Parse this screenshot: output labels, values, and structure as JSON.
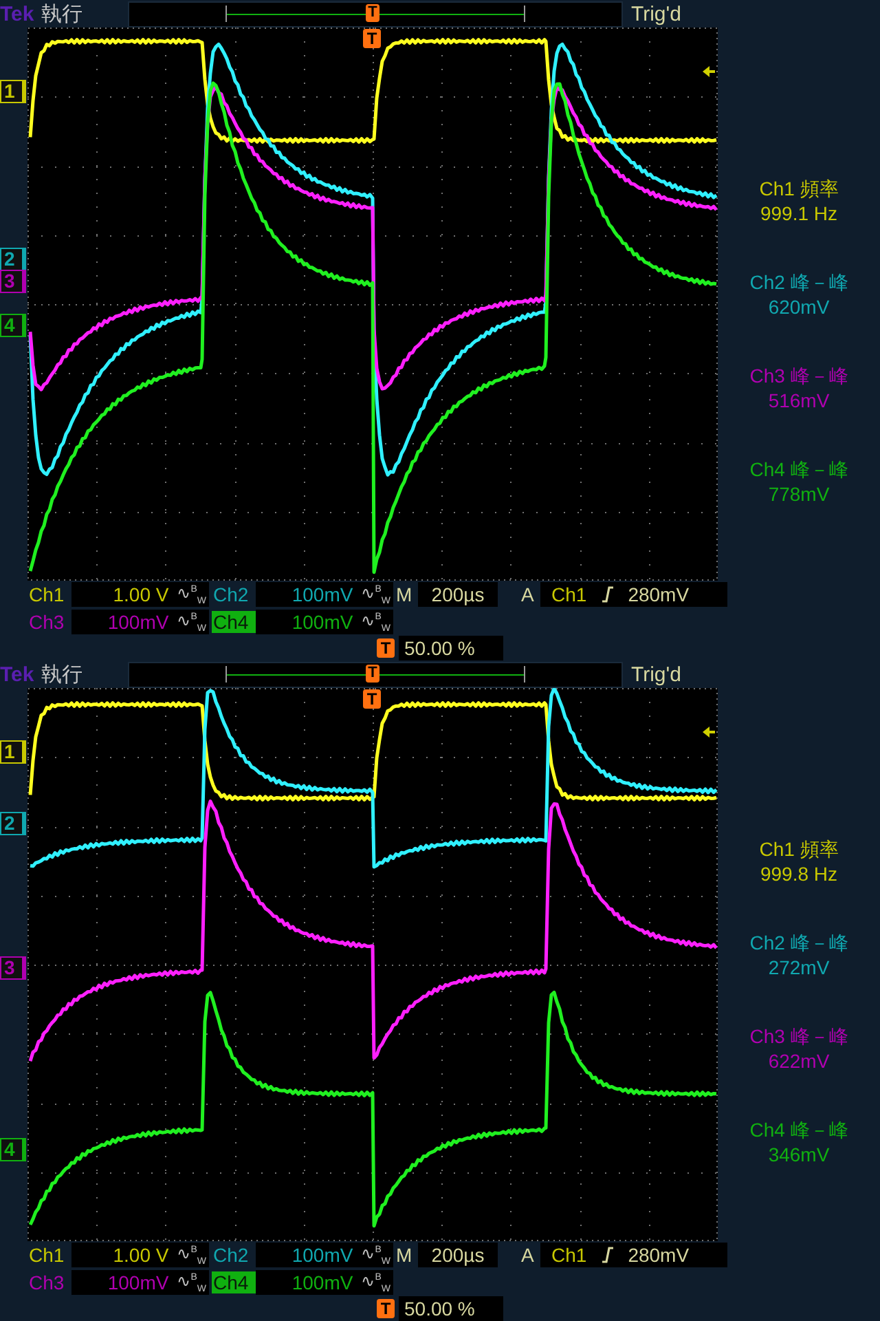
{
  "panels": [
    {
      "header": {
        "brand": "Tek",
        "run_state": "執行",
        "trigger_marker": "T",
        "trigger_status": "Trig'd"
      },
      "plot": {
        "trigger_marker": "T"
      },
      "channel_markers": [
        {
          "label": "1",
          "color": "#c8c800"
        },
        {
          "label": "2",
          "color": "#10a8b0"
        },
        {
          "label": "3",
          "color": "#b000b0"
        },
        {
          "label": "4",
          "color": "#10b010"
        }
      ],
      "traces": [
        {
          "color": "#ffff20"
        },
        {
          "color": "#30f0ff"
        },
        {
          "color": "#ff20ff"
        },
        {
          "color": "#20f020"
        }
      ],
      "measurements": [
        {
          "label": "Ch1 頻率",
          "value": "999.1 Hz",
          "color": "#c8c800"
        },
        {
          "label": "Ch2 峰－峰",
          "value": "620mV",
          "color": "#10a8b0"
        },
        {
          "label": "Ch3 峰－峰",
          "value": "516mV",
          "color": "#b000b0"
        },
        {
          "label": "Ch4 峰－峰",
          "value": "778mV",
          "color": "#10b010"
        }
      ],
      "settings_rows": [
        [
          {
            "kind": "channel",
            "label": "Ch1",
            "value": "1.00 V",
            "bw": "∿$^{B}$$_{W}$",
            "selected": false,
            "color": "#c8c800"
          },
          {
            "kind": "channel",
            "label": "Ch2",
            "value": "100mV",
            "bw": "∿$^{B}$$_{W}$",
            "selected": false,
            "color": "#10a8b0"
          },
          {
            "kind": "timebase",
            "label": "M",
            "value": "200µs"
          },
          {
            "kind": "trigger",
            "label": "A",
            "source": "Ch1",
            "threshold": "280mV"
          }
        ],
        [
          {
            "kind": "channel",
            "label": "Ch3",
            "value": "100mV",
            "bw": "∿$^{B}$$_{W}$",
            "selected": false,
            "color": "#b000b0"
          },
          {
            "kind": "channel",
            "label": "Ch4",
            "value": "100mV",
            "bw": "∿$^{B}$$_{W}$",
            "selected": true,
            "color": "#10b010"
          }
        ]
      ],
      "trigger_position": {
        "marker": "T",
        "value": "50.00 %"
      }
    },
    {
      "header": {
        "brand": "Tek",
        "run_state": "執行",
        "trigger_marker": "T",
        "trigger_status": "Trig'd"
      },
      "plot": {
        "trigger_marker": "T"
      },
      "channel_markers": [
        {
          "label": "1",
          "color": "#c8c800"
        },
        {
          "label": "2",
          "color": "#10a8b0"
        },
        {
          "label": "3",
          "color": "#b000b0"
        },
        {
          "label": "4",
          "color": "#10b010"
        }
      ],
      "traces": [
        {
          "color": "#ffff20"
        },
        {
          "color": "#30f0ff"
        },
        {
          "color": "#ff20ff"
        },
        {
          "color": "#20f020"
        }
      ],
      "measurements": [
        {
          "label": "Ch1 頻率",
          "value": "999.8 Hz",
          "color": "#c8c800"
        },
        {
          "label": "Ch2 峰－峰",
          "value": "272mV",
          "color": "#10a8b0"
        },
        {
          "label": "Ch3 峰－峰",
          "value": "622mV",
          "color": "#b000b0"
        },
        {
          "label": "Ch4 峰－峰",
          "value": "346mV",
          "color": "#10b010"
        }
      ],
      "settings_rows": [
        [
          {
            "kind": "channel",
            "label": "Ch1",
            "value": "1.00 V",
            "bw": "∿$^{B}$$_{W}$",
            "selected": false,
            "color": "#c8c800"
          },
          {
            "kind": "channel",
            "label": "Ch2",
            "value": "100mV",
            "bw": "∿$^{B}$$_{W}$",
            "selected": false,
            "color": "#10a8b0"
          },
          {
            "kind": "timebase",
            "label": "M",
            "value": "200µs"
          },
          {
            "kind": "trigger",
            "label": "A",
            "source": "Ch1",
            "threshold": "280mV"
          }
        ],
        [
          {
            "kind": "channel",
            "label": "Ch3",
            "value": "100mV",
            "bw": "∿$^{B}$$_{W}$",
            "selected": false,
            "color": "#b000b0"
          },
          {
            "kind": "channel",
            "label": "Ch4",
            "value": "100mV",
            "bw": "∿$^{B}$$_{W}$",
            "selected": true,
            "color": "#10b010"
          }
        ]
      ],
      "trigger_position": {
        "marker": "T",
        "value": "50.00 %"
      }
    }
  ]
}
